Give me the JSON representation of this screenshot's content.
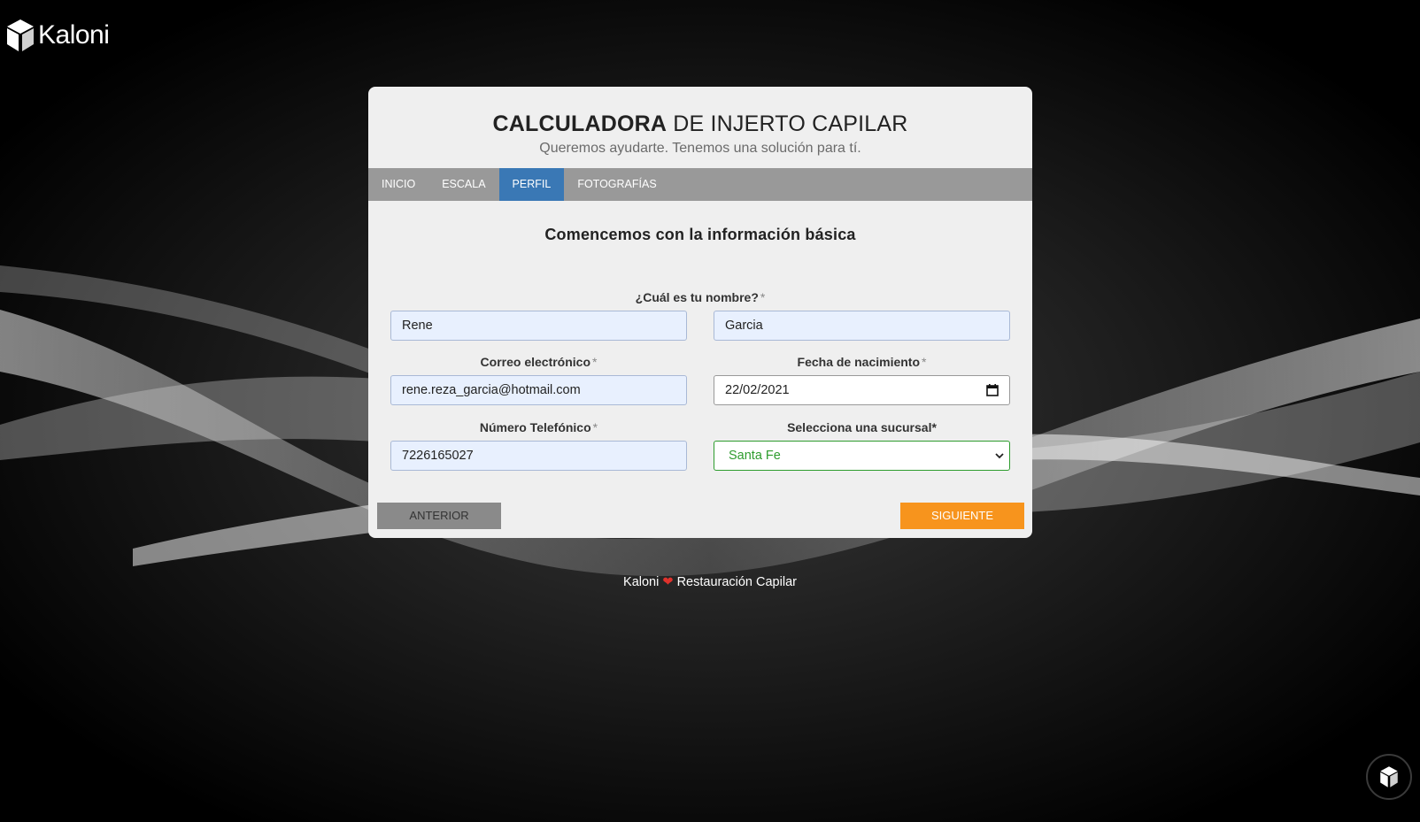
{
  "brand": {
    "name": "Kaloni"
  },
  "header": {
    "title_bold": "CALCULADORA",
    "title_rest": " DE INJERTO CAPILAR",
    "subtitle": "Queremos ayudarte. Tenemos una solución para tí."
  },
  "tabs": [
    {
      "label": "INICIO",
      "active": false
    },
    {
      "label": "ESCALA",
      "active": false
    },
    {
      "label": "PERFIL",
      "active": true
    },
    {
      "label": "FOTOGRAFÍAS",
      "active": false
    }
  ],
  "form": {
    "section_title": "Comencemos con la información básica",
    "required_mark": "*",
    "name_label": "¿Cuál es tu nombre?",
    "first_name_value": "Rene",
    "last_name_value": "Garcia",
    "email_label": "Correo electrónico",
    "email_value": "rene.reza_garcia@hotmail.com",
    "birthdate_label": "Fecha de nacimiento",
    "birthdate_value": "22/02/2021",
    "phone_label": "Número Telefónico",
    "phone_value": "7226165027",
    "branch_label": "Selecciona una sucursal*",
    "branch_value": "Santa Fe"
  },
  "buttons": {
    "prev": "ANTERIOR",
    "next": "SIGUIENTE"
  },
  "footer": {
    "left": "Kaloni",
    "heart": "❤",
    "right": "Restauración Capilar"
  },
  "colors": {
    "active_tab": "#3a78b5",
    "next_button": "#f7941d",
    "select_valid": "#2e9c2e"
  }
}
